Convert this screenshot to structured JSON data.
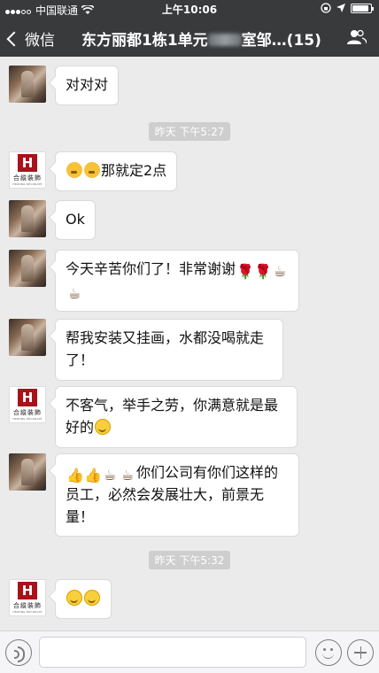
{
  "status_bar": {
    "carrier": "中国联通",
    "time": "上午10:06",
    "battery_level": 0.9
  },
  "nav": {
    "back_label": "微信",
    "chat_title": "东方丽都1栋1单元",
    "chat_title_suffix": "室邹…(15)"
  },
  "messages": [
    {
      "sender": "photo",
      "text": "对对对"
    },
    {
      "sender": "logo",
      "text": "那就定2点",
      "emojis": [
        "thinking",
        "thinking"
      ]
    },
    {
      "sender": "photo",
      "text": "Ok"
    },
    {
      "sender": "photo",
      "text": "今天辛苦你们了！非常谢谢",
      "emojis": [
        "rose",
        "rose",
        "coffee",
        "coffee"
      ]
    },
    {
      "sender": "photo",
      "text": "帮我安装又挂画，水都没喝就走了！"
    },
    {
      "sender": "logo",
      "text": "不客气，举手之劳，你满意就是最好的",
      "emojis": [
        "smile"
      ]
    },
    {
      "sender": "photo",
      "text": "你们公司有你们这样的员工，必然会发展壮大，前景无量！",
      "emojis": [
        "thumbs-up",
        "thumbs-up",
        "coffee",
        "coffee"
      ]
    },
    {
      "sender": "logo",
      "text": "",
      "emojis": [
        "smile",
        "smile"
      ]
    }
  ],
  "timestamps": [
    "昨天 下午5:27",
    "昨天 下午5:32"
  ],
  "logo": {
    "cn": "合縱裝飾",
    "en": "HEZONG DECORATE",
    "mark": "H"
  },
  "input": {
    "placeholder": ""
  },
  "icons": {
    "back": "chevron-left-icon",
    "group": "people-icon",
    "voice": "voice-icon",
    "emoji": "emoji-icon",
    "plus": "plus-icon",
    "wifi": "wifi-icon",
    "location": "location-arrow-icon",
    "lock": "orientation-lock-icon"
  }
}
